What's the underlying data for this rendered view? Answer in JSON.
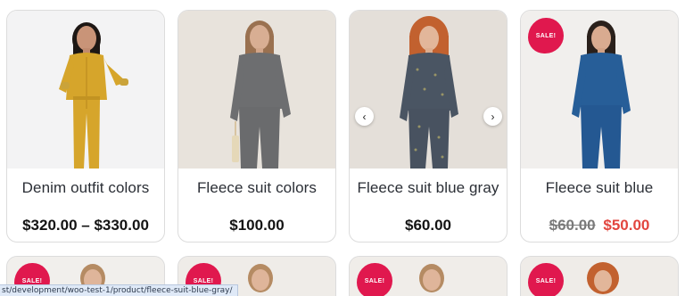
{
  "products": [
    {
      "title": "Denim outfit colors",
      "price": "$320.00 – $330.00",
      "sale": false
    },
    {
      "title": "Fleece suit colors",
      "price": "$100.00",
      "sale": false
    },
    {
      "title": "Fleece suit blue gray",
      "price": "$60.00",
      "sale": false
    },
    {
      "title": "Fleece suit blue",
      "old_price": "$60.00",
      "new_price": "$50.00",
      "sale": true
    }
  ],
  "sale_badge_label": "SALE!",
  "status_bar_url": "st/development/woo-test-1/product/fleece-suit-blue-gray/",
  "icons": {
    "prev": "chevron-left-icon",
    "next": "chevron-right-icon"
  },
  "colors": {
    "sale": "#e0184e",
    "sale_price": "#e2463f"
  }
}
